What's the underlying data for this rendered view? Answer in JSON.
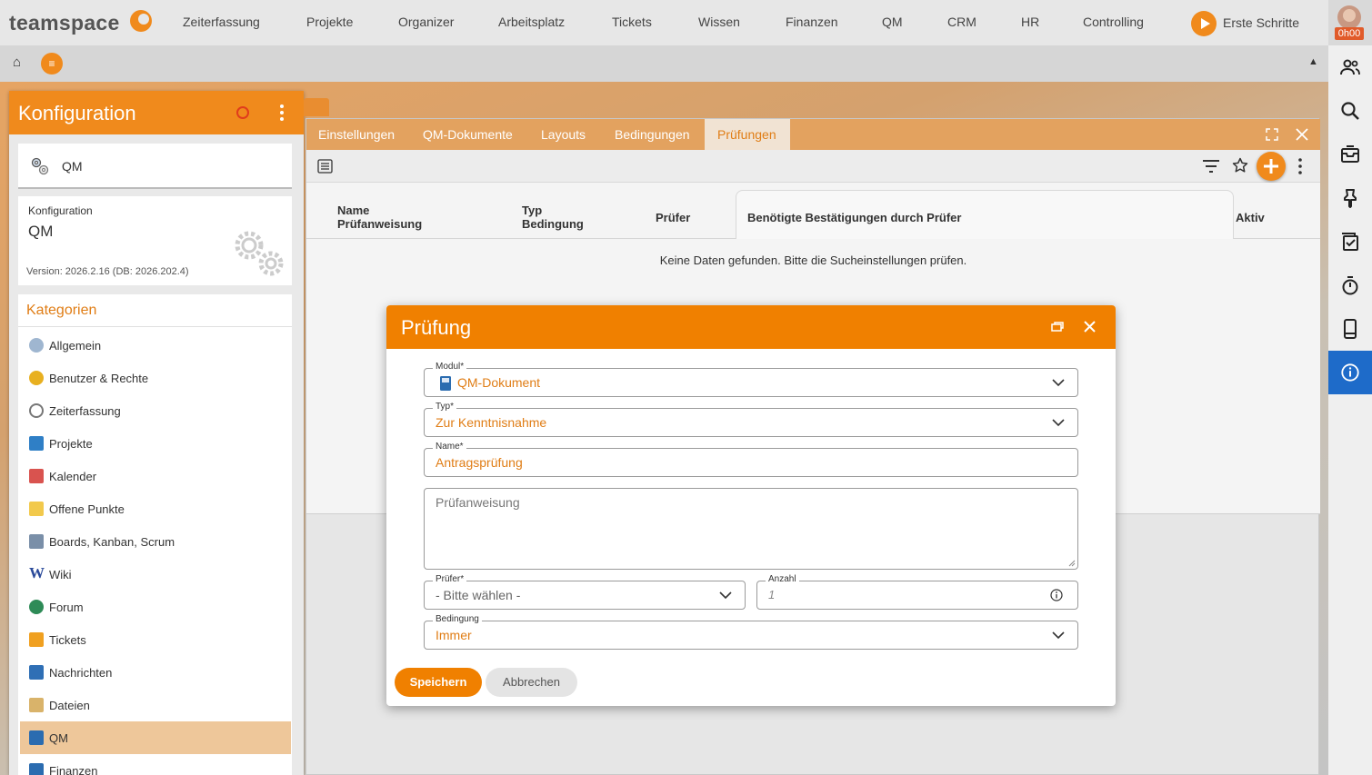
{
  "app": {
    "logo_text": "teamspace"
  },
  "topnav": {
    "items": [
      "Zeiterfassung",
      "Projekte",
      "Organizer",
      "Arbeitsplatz",
      "Tickets",
      "Wissen",
      "Finanzen",
      "QM",
      "CRM",
      "HR",
      "Controlling"
    ],
    "erste_schritte": "Erste Schritte",
    "time_badge": "0h00"
  },
  "toolbar": {
    "home_icon": "home-icon",
    "menu_icon": "menu-icon"
  },
  "konfig": {
    "title": "Konfiguration",
    "module_label": "QM",
    "info_key": "Konfiguration",
    "info_value": "QM",
    "version": "Version: 2026.2.16 (DB: 2026.202.4)",
    "categories_title": "Kategorien",
    "categories": [
      {
        "label": "Allgemein",
        "icon": "gears-icon"
      },
      {
        "label": "Benutzer & Rechte",
        "icon": "users-icon"
      },
      {
        "label": "Zeiterfassung",
        "icon": "stopwatch-icon"
      },
      {
        "label": "Projekte",
        "icon": "folder-icon"
      },
      {
        "label": "Kalender",
        "icon": "calendar-icon"
      },
      {
        "label": "Offene Punkte",
        "icon": "note-icon"
      },
      {
        "label": "Boards, Kanban, Scrum",
        "icon": "board-icon"
      },
      {
        "label": "Wiki",
        "icon": "wiki-icon"
      },
      {
        "label": "Forum",
        "icon": "forum-icon"
      },
      {
        "label": "Tickets",
        "icon": "ticket-icon"
      },
      {
        "label": "Nachrichten",
        "icon": "messages-icon"
      },
      {
        "label": "Dateien",
        "icon": "files-icon"
      },
      {
        "label": "QM",
        "icon": "qm-icon"
      },
      {
        "label": "Finanzen",
        "icon": "finance-icon"
      }
    ],
    "active_category": "QM"
  },
  "main": {
    "tabs": [
      "Einstellungen",
      "QM-Dokumente",
      "Layouts",
      "Bedingungen",
      "Prüfungen"
    ],
    "active_tab": "Prüfungen",
    "columns": {
      "name": "Name",
      "name_sub": "Prüfanweisung",
      "typ": "Typ",
      "typ_sub": "Bedingung",
      "pruefer": "Prüfer",
      "bestaetigungen": "Benötigte Bestätigungen durch Prüfer",
      "aktiv": "Aktiv"
    },
    "empty_message": "Keine Daten gefunden. Bitte die Sucheinstellungen prüfen."
  },
  "dialog": {
    "title": "Prüfung",
    "modul": {
      "label": "Modul*",
      "value": "QM-Dokument"
    },
    "typ": {
      "label": "Typ*",
      "value": "Zur Kenntnisnahme"
    },
    "name": {
      "label": "Name*",
      "value": "Antragsprüfung"
    },
    "pruefanweisung": {
      "placeholder": "Prüfanweisung"
    },
    "pruefer": {
      "label": "Prüfer*",
      "value": "- Bitte wählen -"
    },
    "anzahl": {
      "label": "Anzahl",
      "placeholder": "1"
    },
    "bedingung": {
      "label": "Bedingung",
      "value": "Immer"
    },
    "save_label": "Speichern",
    "cancel_label": "Abbrechen"
  },
  "colors": {
    "accent": "#f08000",
    "tab_bar": "#e3a25f",
    "active_sidebar": "#1e6bc9"
  }
}
